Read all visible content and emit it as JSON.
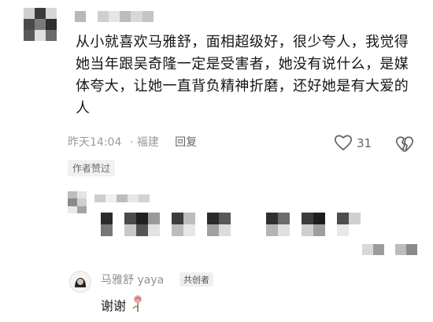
{
  "comment": {
    "text": "从小就喜欢马雅舒，面相超级好，很少夸人，我觉得她当年跟吴奇隆一定是受害者，她没有说什么，是媒体夸大，让她一直背负精神折磨，还好她是有大爱的人",
    "time": "昨天14:04",
    "location": "· 福建",
    "reply_label": "回复",
    "like_count": "31",
    "author_liked_label": "作者赞过"
  },
  "reply": {
    "username": "马雅舒 yaya",
    "badge": "共创者",
    "text": "谢谢"
  },
  "icons": {
    "like": "heart-outline-icon",
    "dislike": "broken-heart-icon",
    "reply_emoji": "rose-icon"
  },
  "colors": {
    "meta_gray": "#9a9a9a",
    "text": "#161616",
    "badge_bg": "#f1f1f1"
  }
}
